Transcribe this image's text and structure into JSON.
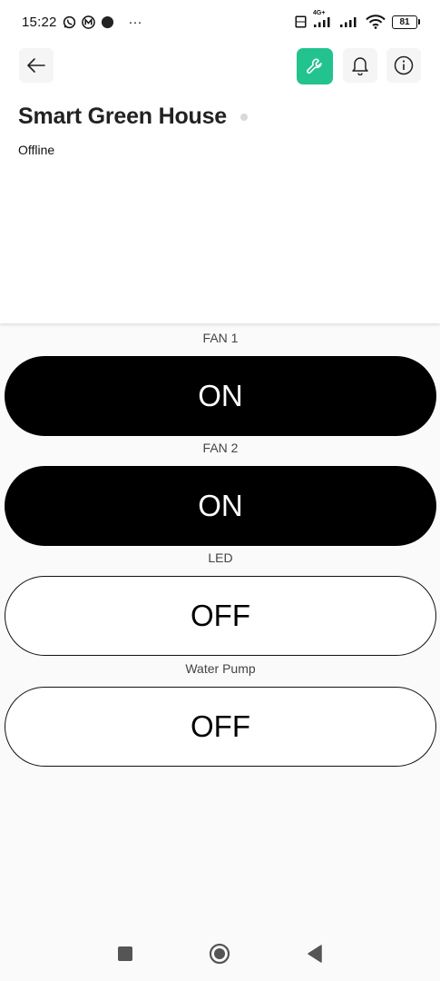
{
  "status_bar": {
    "time": "15:22",
    "more": "···",
    "network_label": "4G+",
    "battery": "81",
    "icons": [
      "whatsapp-icon",
      "app-m-icon",
      "notification-dot-icon",
      "volte-icon",
      "signal-icon",
      "signal-icon",
      "wifi-icon",
      "battery-icon"
    ]
  },
  "header": {
    "title": "Smart Green House",
    "connection_status": "Offline",
    "actions": [
      "back-arrow-icon",
      "wrench-icon",
      "bell-icon",
      "info-icon"
    ],
    "accent_color": "#22c38e"
  },
  "controls": [
    {
      "label": "FAN 1",
      "state": "ON"
    },
    {
      "label": "FAN 2",
      "state": "ON"
    },
    {
      "label": "LED",
      "state": "OFF"
    },
    {
      "label": "Water Pump",
      "state": "OFF"
    }
  ],
  "navbar": {
    "buttons": [
      "recents-square-icon",
      "home-circle-icon",
      "back-triangle-icon"
    ]
  }
}
